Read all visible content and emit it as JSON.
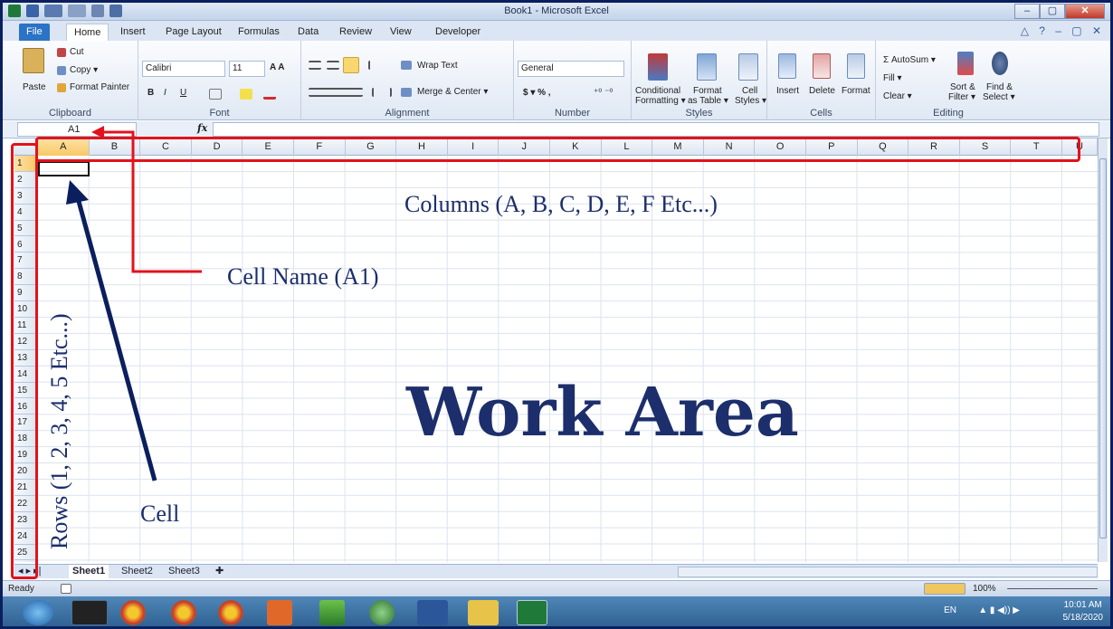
{
  "window": {
    "title": "Book1 - Microsoft Excel",
    "minimize": "–",
    "maximize": "▢",
    "close": "✕"
  },
  "tabs": [
    "File",
    "Home",
    "Insert",
    "Page Layout",
    "Formulas",
    "Data",
    "Review",
    "View",
    "Developer"
  ],
  "ribbon": {
    "clipboard": {
      "label": "Clipboard",
      "paste": "Paste",
      "cut": "Cut",
      "copy": "Copy ▾",
      "format_painter": "Format Painter"
    },
    "font": {
      "label": "Font",
      "font_name": "Calibri",
      "font_size": "11",
      "bold": "B",
      "italic": "I",
      "underline": "U"
    },
    "alignment": {
      "label": "Alignment",
      "wrap_text": "Wrap Text",
      "merge_center": "Merge & Center ▾"
    },
    "number": {
      "label": "Number",
      "format": "General",
      "currency": "$ ▾ %  ,"
    },
    "styles": {
      "label": "Styles",
      "conditional": "Conditional",
      "conditional2": "Formatting ▾",
      "format_as": "Format",
      "format_as2": "as Table ▾",
      "cell": "Cell",
      "cell2": "Styles ▾"
    },
    "cells": {
      "label": "Cells",
      "insert": "Insert",
      "delete": "Delete",
      "format": "Format"
    },
    "editing": {
      "label": "Editing",
      "autosum": "Σ AutoSum ▾",
      "fill": "Fill ▾",
      "clear": "Clear ▾",
      "sort": "Sort &",
      "sort2": "Filter ▾",
      "find": "Find &",
      "find2": "Select ▾"
    }
  },
  "formula_bar": {
    "name_box": "A1",
    "fx": "fx"
  },
  "columns": [
    "A",
    "B",
    "C",
    "D",
    "E",
    "F",
    "G",
    "H",
    "I",
    "J",
    "K",
    "L",
    "M",
    "N",
    "O",
    "P",
    "Q",
    "R",
    "S",
    "T",
    "U"
  ],
  "rows": [
    "1",
    "2",
    "3",
    "4",
    "5",
    "6",
    "7",
    "8",
    "9",
    "10",
    "11",
    "12",
    "13",
    "14",
    "15",
    "16",
    "17",
    "18",
    "19",
    "20",
    "21",
    "22",
    "23",
    "24",
    "25"
  ],
  "sheets": [
    "Sheet1",
    "Sheet2",
    "Sheet3"
  ],
  "status": {
    "ready": "Ready",
    "zoom": "100%"
  },
  "taskbar": {
    "lang": "EN",
    "time": "10:01 AM",
    "date": "5/18/2020"
  },
  "annotations": {
    "columns": "Columns (A, B, C, D, E, F Etc...)",
    "cell_name": "Cell Name (A1)",
    "rows": "Rows (1, 2, 3, 4, 5 Etc...)",
    "cell": "Cell",
    "work_area": "Work Area"
  },
  "colors": {
    "annotation": "#1c2e6b",
    "highlight": "#e3121b"
  }
}
